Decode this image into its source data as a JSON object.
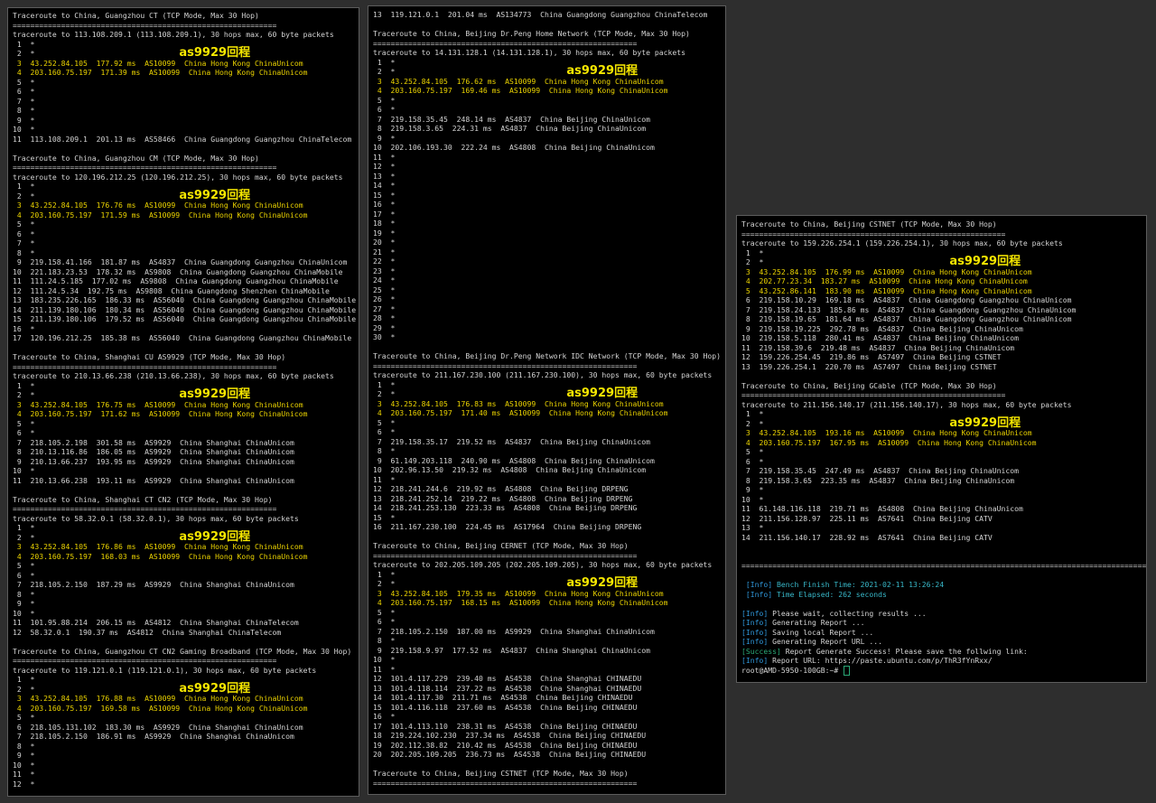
{
  "annotation_text": "as9929回程",
  "colors": {
    "background": "#2e2e2e",
    "terminal_bg": "#000000",
    "text": "#d4d4d4",
    "highlight_hop": "#ecd400",
    "annotation": "#f5e600",
    "info_tag": "#2f96d8",
    "success_tag": "#2aa876",
    "timing": "#38b7c8"
  },
  "terminals": [
    {
      "lines": [
        {
          "t": "Traceroute to China, Guangzhou CT (TCP Mode, Max 30 Hop)"
        },
        {
          "t": "============================================================"
        },
        {
          "t": "traceroute to 113.108.209.1 (113.108.209.1), 30 hops max, 60 byte packets"
        },
        {
          "t": " 1  *"
        },
        {
          "t": " 2  *",
          "note": true
        },
        {
          "t": " 3  43.252.84.105  177.92 ms  AS10099  China Hong Kong ChinaUnicom",
          "s": "y"
        },
        {
          "t": " 4  203.160.75.197  171.39 ms  AS10099  China Hong Kong ChinaUnicom",
          "s": "y"
        },
        {
          "t": " 5  *"
        },
        {
          "t": " 6  *"
        },
        {
          "t": " 7  *"
        },
        {
          "t": " 8  *"
        },
        {
          "t": " 9  *"
        },
        {
          "t": "10  *"
        },
        {
          "t": "11  113.108.209.1  201.13 ms  AS58466  China Guangdong Guangzhou ChinaTelecom"
        },
        {
          "t": ""
        },
        {
          "t": "Traceroute to China, Guangzhou CM (TCP Mode, Max 30 Hop)"
        },
        {
          "t": "============================================================"
        },
        {
          "t": "traceroute to 120.196.212.25 (120.196.212.25), 30 hops max, 60 byte packets"
        },
        {
          "t": " 1  *"
        },
        {
          "t": " 2  *",
          "note": true
        },
        {
          "t": " 3  43.252.84.105  176.76 ms  AS10099  China Hong Kong ChinaUnicom",
          "s": "y"
        },
        {
          "t": " 4  203.160.75.197  171.59 ms  AS10099  China Hong Kong ChinaUnicom",
          "s": "y"
        },
        {
          "t": " 5  *"
        },
        {
          "t": " 6  *"
        },
        {
          "t": " 7  *"
        },
        {
          "t": " 8  *"
        },
        {
          "t": " 9  219.158.41.166  181.87 ms  AS4837  China Guangdong Guangzhou ChinaUnicom"
        },
        {
          "t": "10  221.183.23.53  178.32 ms  AS9808  China Guangdong Guangzhou ChinaMobile"
        },
        {
          "t": "11  111.24.5.185  177.02 ms  AS9808  China Guangdong Guangzhou ChinaMobile"
        },
        {
          "t": "12  111.24.5.34  192.75 ms  AS9808  China Guangdong Shenzhen ChinaMobile"
        },
        {
          "t": "13  183.235.226.165  186.33 ms  AS56040  China Guangdong Guangzhou ChinaMobile"
        },
        {
          "t": "14  211.139.180.106  180.34 ms  AS56040  China Guangdong Guangzhou ChinaMobile"
        },
        {
          "t": "15  211.139.180.106  179.52 ms  AS56040  China Guangdong Guangzhou ChinaMobile"
        },
        {
          "t": "16  *"
        },
        {
          "t": "17  120.196.212.25  185.38 ms  AS56040  China Guangdong Guangzhou ChinaMobile"
        },
        {
          "t": ""
        },
        {
          "t": "Traceroute to China, Shanghai CU AS9929 (TCP Mode, Max 30 Hop)"
        },
        {
          "t": "============================================================"
        },
        {
          "t": "traceroute to 210.13.66.238 (210.13.66.238), 30 hops max, 60 byte packets"
        },
        {
          "t": " 1  *"
        },
        {
          "t": " 2  *",
          "note": true
        },
        {
          "t": " 3  43.252.84.105  176.75 ms  AS10099  China Hong Kong ChinaUnicom",
          "s": "y"
        },
        {
          "t": " 4  203.160.75.197  171.62 ms  AS10099  China Hong Kong ChinaUnicom",
          "s": "y"
        },
        {
          "t": " 5  *"
        },
        {
          "t": " 6  *"
        },
        {
          "t": " 7  218.105.2.198  301.58 ms  AS9929  China Shanghai ChinaUnicom"
        },
        {
          "t": " 8  210.13.116.86  186.05 ms  AS9929  China Shanghai ChinaUnicom"
        },
        {
          "t": " 9  210.13.66.237  193.95 ms  AS9929  China Shanghai ChinaUnicom"
        },
        {
          "t": "10  *"
        },
        {
          "t": "11  210.13.66.238  193.11 ms  AS9929  China Shanghai ChinaUnicom"
        },
        {
          "t": ""
        },
        {
          "t": "Traceroute to China, Shanghai CT CN2 (TCP Mode, Max 30 Hop)"
        },
        {
          "t": "============================================================"
        },
        {
          "t": "traceroute to 58.32.0.1 (58.32.0.1), 30 hops max, 60 byte packets"
        },
        {
          "t": " 1  *"
        },
        {
          "t": " 2  *",
          "note": true
        },
        {
          "t": " 3  43.252.84.105  176.86 ms  AS10099  China Hong Kong ChinaUnicom",
          "s": "y"
        },
        {
          "t": " 4  203.160.75.197  168.03 ms  AS10099  China Hong Kong ChinaUnicom",
          "s": "y"
        },
        {
          "t": " 5  *"
        },
        {
          "t": " 6  *"
        },
        {
          "t": " 7  218.105.2.150  187.29 ms  AS9929  China Shanghai ChinaUnicom"
        },
        {
          "t": " 8  *"
        },
        {
          "t": " 9  *"
        },
        {
          "t": "10  *"
        },
        {
          "t": "11  101.95.88.214  206.15 ms  AS4812  China Shanghai ChinaTelecom"
        },
        {
          "t": "12  58.32.0.1  190.37 ms  AS4812  China Shanghai ChinaTelecom"
        },
        {
          "t": ""
        },
        {
          "t": "Traceroute to China, Guangzhou CT CN2 Gaming Broadband (TCP Mode, Max 30 Hop)"
        },
        {
          "t": "============================================================"
        },
        {
          "t": "traceroute to 119.121.0.1 (119.121.0.1), 30 hops max, 60 byte packets"
        },
        {
          "t": " 1  *"
        },
        {
          "t": " 2  *",
          "note": true
        },
        {
          "t": " 3  43.252.84.105  176.88 ms  AS10099  China Hong Kong ChinaUnicom",
          "s": "y"
        },
        {
          "t": " 4  203.160.75.197  169.58 ms  AS10099  China Hong Kong ChinaUnicom",
          "s": "y"
        },
        {
          "t": " 5  *"
        },
        {
          "t": " 6  218.105.131.102  183.30 ms  AS9929  China Shanghai ChinaUnicom"
        },
        {
          "t": " 7  218.105.2.150  186.91 ms  AS9929  China Shanghai ChinaUnicom"
        },
        {
          "t": " 8  *"
        },
        {
          "t": " 9  *"
        },
        {
          "t": "10  *"
        },
        {
          "t": "11  *"
        },
        {
          "t": "12  *"
        }
      ]
    },
    {
      "lines": [
        {
          "t": "13  119.121.0.1  201.04 ms  AS134773  China Guangdong Guangzhou ChinaTelecom"
        },
        {
          "t": ""
        },
        {
          "t": "Traceroute to China, Beijing Dr.Peng Home Network (TCP Mode, Max 30 Hop)"
        },
        {
          "t": "============================================================"
        },
        {
          "t": "traceroute to 14.131.128.1 (14.131.128.1), 30 hops max, 60 byte packets"
        },
        {
          "t": " 1  *"
        },
        {
          "t": " 2  *",
          "note": true
        },
        {
          "t": " 3  43.252.84.105  176.62 ms  AS10099  China Hong Kong ChinaUnicom",
          "s": "y"
        },
        {
          "t": " 4  203.160.75.197  169.46 ms  AS10099  China Hong Kong ChinaUnicom",
          "s": "y"
        },
        {
          "t": " 5  *"
        },
        {
          "t": " 6  *"
        },
        {
          "t": " 7  219.158.35.45  248.14 ms  AS4837  China Beijing ChinaUnicom"
        },
        {
          "t": " 8  219.158.3.65  224.31 ms  AS4837  China Beijing ChinaUnicom"
        },
        {
          "t": " 9  *"
        },
        {
          "t": "10  202.106.193.30  222.24 ms  AS4808  China Beijing ChinaUnicom"
        },
        {
          "t": "11  *"
        },
        {
          "t": "12  *"
        },
        {
          "t": "13  *"
        },
        {
          "t": "14  *"
        },
        {
          "t": "15  *"
        },
        {
          "t": "16  *"
        },
        {
          "t": "17  *"
        },
        {
          "t": "18  *"
        },
        {
          "t": "19  *"
        },
        {
          "t": "20  *"
        },
        {
          "t": "21  *"
        },
        {
          "t": "22  *"
        },
        {
          "t": "23  *"
        },
        {
          "t": "24  *"
        },
        {
          "t": "25  *"
        },
        {
          "t": "26  *"
        },
        {
          "t": "27  *"
        },
        {
          "t": "28  *"
        },
        {
          "t": "29  *"
        },
        {
          "t": "30  *"
        },
        {
          "t": ""
        },
        {
          "t": "Traceroute to China, Beijing Dr.Peng Network IDC Network (TCP Mode, Max 30 Hop)"
        },
        {
          "t": "============================================================"
        },
        {
          "t": "traceroute to 211.167.230.100 (211.167.230.100), 30 hops max, 60 byte packets"
        },
        {
          "t": " 1  *"
        },
        {
          "t": " 2  *",
          "note": true
        },
        {
          "t": " 3  43.252.84.105  176.83 ms  AS10099  China Hong Kong ChinaUnicom",
          "s": "y"
        },
        {
          "t": " 4  203.160.75.197  171.40 ms  AS10099  China Hong Kong ChinaUnicom",
          "s": "y"
        },
        {
          "t": " 5  *"
        },
        {
          "t": " 6  *"
        },
        {
          "t": " 7  219.158.35.17  219.52 ms  AS4837  China Beijing ChinaUnicom"
        },
        {
          "t": " 8  *"
        },
        {
          "t": " 9  61.149.203.118  240.90 ms  AS4808  China Beijing ChinaUnicom"
        },
        {
          "t": "10  202.96.13.50  219.32 ms  AS4808  China Beijing ChinaUnicom"
        },
        {
          "t": "11  *"
        },
        {
          "t": "12  218.241.244.6  219.92 ms  AS4808  China Beijing DRPENG"
        },
        {
          "t": "13  218.241.252.14  219.22 ms  AS4808  China Beijing DRPENG"
        },
        {
          "t": "14  218.241.253.130  223.33 ms  AS4808  China Beijing DRPENG"
        },
        {
          "t": "15  *"
        },
        {
          "t": "16  211.167.230.100  224.45 ms  AS17964  China Beijing DRPENG"
        },
        {
          "t": ""
        },
        {
          "t": "Traceroute to China, Beijing CERNET (TCP Mode, Max 30 Hop)"
        },
        {
          "t": "============================================================"
        },
        {
          "t": "traceroute to 202.205.109.205 (202.205.109.205), 30 hops max, 60 byte packets"
        },
        {
          "t": " 1  *"
        },
        {
          "t": " 2  *",
          "note": true
        },
        {
          "t": " 3  43.252.84.105  179.35 ms  AS10099  China Hong Kong ChinaUnicom",
          "s": "y"
        },
        {
          "t": " 4  203.160.75.197  168.15 ms  AS10099  China Hong Kong ChinaUnicom",
          "s": "y"
        },
        {
          "t": " 5  *"
        },
        {
          "t": " 6  *"
        },
        {
          "t": " 7  218.105.2.150  187.00 ms  AS9929  China Shanghai ChinaUnicom"
        },
        {
          "t": " 8  *"
        },
        {
          "t": " 9  219.158.9.97  177.52 ms  AS4837  China Shanghai ChinaUnicom"
        },
        {
          "t": "10  *"
        },
        {
          "t": "11  *"
        },
        {
          "t": "12  101.4.117.229  239.40 ms  AS4538  China Shanghai CHINAEDU"
        },
        {
          "t": "13  101.4.118.114  237.22 ms  AS4538  China Shanghai CHINAEDU"
        },
        {
          "t": "14  101.4.117.30  211.71 ms  AS4538  China Beijing CHINAEDU"
        },
        {
          "t": "15  101.4.116.118  237.60 ms  AS4538  China Beijing CHINAEDU"
        },
        {
          "t": "16  *"
        },
        {
          "t": "17  101.4.113.110  238.31 ms  AS4538  China Beijing CHINAEDU"
        },
        {
          "t": "18  219.224.102.230  237.34 ms  AS4538  China Beijing CHINAEDU"
        },
        {
          "t": "19  202.112.38.82  210.42 ms  AS4538  China Beijing CHINAEDU"
        },
        {
          "t": "20  202.205.109.205  236.73 ms  AS4538  China Beijing CHINAEDU"
        },
        {
          "t": ""
        },
        {
          "t": "Traceroute to China, Beijing CSTNET (TCP Mode, Max 30 Hop)"
        },
        {
          "t": "============================================================"
        }
      ]
    },
    {
      "lines": [
        {
          "t": "Traceroute to China, Beijing CSTNET (TCP Mode, Max 30 Hop)"
        },
        {
          "t": "============================================================"
        },
        {
          "t": "traceroute to 159.226.254.1 (159.226.254.1), 30 hops max, 60 byte packets"
        },
        {
          "t": " 1  *"
        },
        {
          "t": " 2  *",
          "note": true
        },
        {
          "t": " 3  43.252.84.105  176.99 ms  AS10099  China Hong Kong ChinaUnicom",
          "s": "y"
        },
        {
          "t": " 4  202.77.23.34  183.27 ms  AS10099  China Hong Kong ChinaUnicom",
          "s": "y"
        },
        {
          "t": " 5  43.252.86.141  183.90 ms  AS10099  China Hong Kong ChinaUnicom",
          "s": "y"
        },
        {
          "t": " 6  219.158.10.29  169.18 ms  AS4837  China Guangdong Guangzhou ChinaUnicom"
        },
        {
          "t": " 7  219.158.24.133  185.86 ms  AS4837  China Guangdong Guangzhou ChinaUnicom"
        },
        {
          "t": " 8  219.158.19.65  181.64 ms  AS4837  China Guangdong Guangzhou ChinaUnicom"
        },
        {
          "t": " 9  219.158.19.225  292.78 ms  AS4837  China Beijing ChinaUnicom"
        },
        {
          "t": "10  219.158.5.118  280.41 ms  AS4837  China Beijing ChinaUnicom"
        },
        {
          "t": "11  219.158.39.6  219.48 ms  AS4837  China Beijing ChinaUnicom"
        },
        {
          "t": "12  159.226.254.45  219.86 ms  AS7497  China Beijing CSTNET"
        },
        {
          "t": "13  159.226.254.1  220.70 ms  AS7497  China Beijing CSTNET"
        },
        {
          "t": ""
        },
        {
          "t": "Traceroute to China, Beijing GCable (TCP Mode, Max 30 Hop)"
        },
        {
          "t": "============================================================"
        },
        {
          "t": "traceroute to 211.156.140.17 (211.156.140.17), 30 hops max, 60 byte packets"
        },
        {
          "t": " 1  *"
        },
        {
          "t": " 2  *",
          "note": true
        },
        {
          "t": " 3  43.252.84.105  193.16 ms  AS10099  China Hong Kong ChinaUnicom",
          "s": "y"
        },
        {
          "t": " 4  203.160.75.197  167.95 ms  AS10099  China Hong Kong ChinaUnicom",
          "s": "y"
        },
        {
          "t": " 5  *"
        },
        {
          "t": " 6  *"
        },
        {
          "t": " 7  219.158.35.45  247.49 ms  AS4837  China Beijing ChinaUnicom"
        },
        {
          "t": " 8  219.158.3.65  223.35 ms  AS4837  China Beijing ChinaUnicom"
        },
        {
          "t": " 9  *"
        },
        {
          "t": "10  *"
        },
        {
          "t": "11  61.148.116.118  219.71 ms  AS4808  China Beijing ChinaUnicom"
        },
        {
          "t": "12  211.156.128.97  225.11 ms  AS7641  China Beijing CATV"
        },
        {
          "t": "13  *"
        },
        {
          "t": "14  211.156.140.17  228.92 ms  AS7641  China Beijing CATV"
        },
        {
          "t": ""
        },
        {
          "t": ""
        },
        {
          "t": "==============================================================================================="
        },
        {
          "t": ""
        },
        {
          "tag": "[Info]",
          "tagc": "b",
          "rest": " Bench Finish Time: 2021-02-11 13:26:24",
          "restc": "c",
          "indent": " "
        },
        {
          "tag": "[Info]",
          "tagc": "b",
          "rest": " Time Elapsed: 262 seconds",
          "restc": "c",
          "indent": " "
        },
        {
          "t": ""
        },
        {
          "tag": "[Info]",
          "tagc": "b",
          "rest": " Please wait, collecting results ..."
        },
        {
          "tag": "[Info]",
          "tagc": "b",
          "rest": " Generating Report ..."
        },
        {
          "tag": "[Info]",
          "tagc": "b",
          "rest": " Saving local Report ..."
        },
        {
          "tag": "[Info]",
          "tagc": "b",
          "rest": " Generating Report URL ..."
        },
        {
          "tag": "[Success]",
          "tagc": "g",
          "rest": " Report Generate Success! Please save the follwing link:"
        },
        {
          "tag": "[Info]",
          "tagc": "b",
          "rest": " Report URL: https://paste.ubuntu.com/p/ThR3fYnRxx/"
        },
        {
          "t": "root@AMD-5950-100GB:~# ",
          "cursor": true
        }
      ]
    }
  ]
}
